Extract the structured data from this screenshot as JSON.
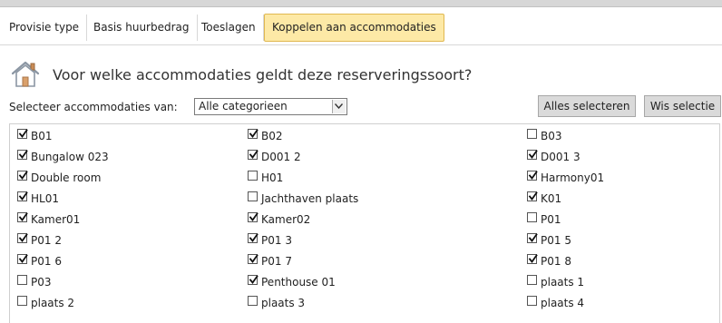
{
  "tabs": [
    {
      "label": "Provisie type",
      "active": false
    },
    {
      "label": "Basis huurbedrag",
      "active": false
    },
    {
      "label": "Toeslagen",
      "active": false
    },
    {
      "label": "Koppelen aan accommodaties",
      "active": true
    }
  ],
  "heading": {
    "title": "Voor welke accommodaties geldt deze reserveringssoort?",
    "icon": "house-icon"
  },
  "filter": {
    "label": "Selecteer accommodaties van:",
    "selected": "Alle categorieen"
  },
  "buttons": {
    "select_all": "Alles selecteren",
    "clear": "Wis selectie"
  },
  "accommodations": [
    {
      "label": "B01",
      "checked": true
    },
    {
      "label": "B02",
      "checked": true
    },
    {
      "label": "B03",
      "checked": false
    },
    {
      "label": "Bungalow 023",
      "checked": true
    },
    {
      "label": "D001 2",
      "checked": true
    },
    {
      "label": "D001 3",
      "checked": true
    },
    {
      "label": "Double room",
      "checked": true
    },
    {
      "label": "H01",
      "checked": false
    },
    {
      "label": "Harmony01",
      "checked": true
    },
    {
      "label": "HL01",
      "checked": true
    },
    {
      "label": "Jachthaven plaats",
      "checked": false
    },
    {
      "label": "K01",
      "checked": true
    },
    {
      "label": "Kamer01",
      "checked": true
    },
    {
      "label": "Kamer02",
      "checked": true
    },
    {
      "label": "P01",
      "checked": false
    },
    {
      "label": "P01 2",
      "checked": true
    },
    {
      "label": "P01 3",
      "checked": true
    },
    {
      "label": "P01 5",
      "checked": true
    },
    {
      "label": "P01 6",
      "checked": true
    },
    {
      "label": "P01 7",
      "checked": true
    },
    {
      "label": "P01 8",
      "checked": true
    },
    {
      "label": "P03",
      "checked": false
    },
    {
      "label": "Penthouse 01",
      "checked": true
    },
    {
      "label": "plaats 1",
      "checked": false
    },
    {
      "label": "plaats 2",
      "checked": false
    },
    {
      "label": "plaats 3",
      "checked": false
    },
    {
      "label": "plaats 4",
      "checked": false
    }
  ]
}
